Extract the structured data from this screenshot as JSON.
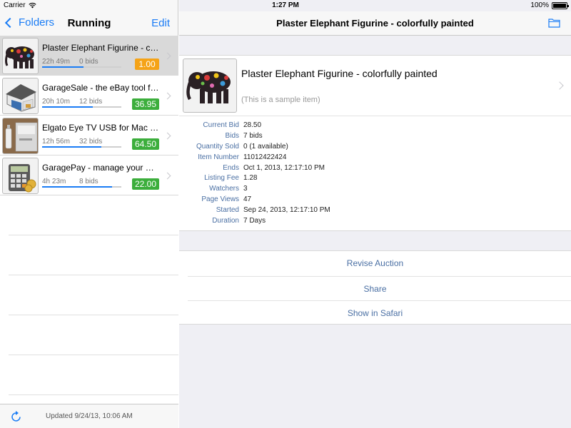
{
  "status_bar": {
    "carrier": "Carrier",
    "time": "1:27 PM",
    "battery": "100%"
  },
  "left_nav": {
    "back_label": "Folders",
    "title": "Running",
    "edit_label": "Edit"
  },
  "items": [
    {
      "title": "Plaster Elephant Figurine - co...",
      "time": "22h 49m",
      "bids": "0 bids",
      "price": "1.00",
      "price_color": "#f5a317",
      "progress": 0.52
    },
    {
      "title": "GarageSale - the eBay tool for Mac...",
      "time": "20h 10m",
      "bids": "12 bids",
      "price": "36.95",
      "price_color": "#3cae3c",
      "progress": 0.64
    },
    {
      "title": "Elgato Eye TV USB for Mac OS X...",
      "time": "12h 56m",
      "bids": "32 bids",
      "price": "64.50",
      "price_color": "#3cae3c",
      "progress": 0.75
    },
    {
      "title": "GaragePay - manage your PayPal...",
      "time": "4h 23m",
      "bids": "8 bids",
      "price": "22.00",
      "price_color": "#3cae3c",
      "progress": 0.88
    }
  ],
  "footer": {
    "updated": "Updated 9/24/13, 10:06 AM"
  },
  "detail": {
    "nav_title": "Plaster Elephant Figurine - colorfully painted",
    "title": "Plaster Elephant Figurine - colorfully painted",
    "subtitle": "(This is a sample item)",
    "fields": [
      {
        "label": "Current Bid",
        "value": "28.50"
      },
      {
        "label": "Bids",
        "value": "7 bids"
      },
      {
        "label": "Quantity Sold",
        "value": "0 (1 available)"
      },
      {
        "label": "Item Number",
        "value": "11012422424"
      },
      {
        "label": "Ends",
        "value": "Oct 1, 2013, 12:17:10 PM"
      },
      {
        "label": "Listing Fee",
        "value": "1.28"
      },
      {
        "label": "Watchers",
        "value": "3"
      },
      {
        "label": "Page Views",
        "value": "47"
      },
      {
        "label": "Started",
        "value": "Sep 24, 2013, 12:17:10 PM"
      },
      {
        "label": "Duration",
        "value": "7 Days"
      }
    ],
    "actions": [
      "Revise Auction",
      "Share",
      "Show in Safari"
    ]
  },
  "colors": {
    "accent": "#1a7cf5",
    "label_blue": "#4a6fa3",
    "badge_orange": "#f5a317",
    "badge_green": "#3cae3c"
  }
}
